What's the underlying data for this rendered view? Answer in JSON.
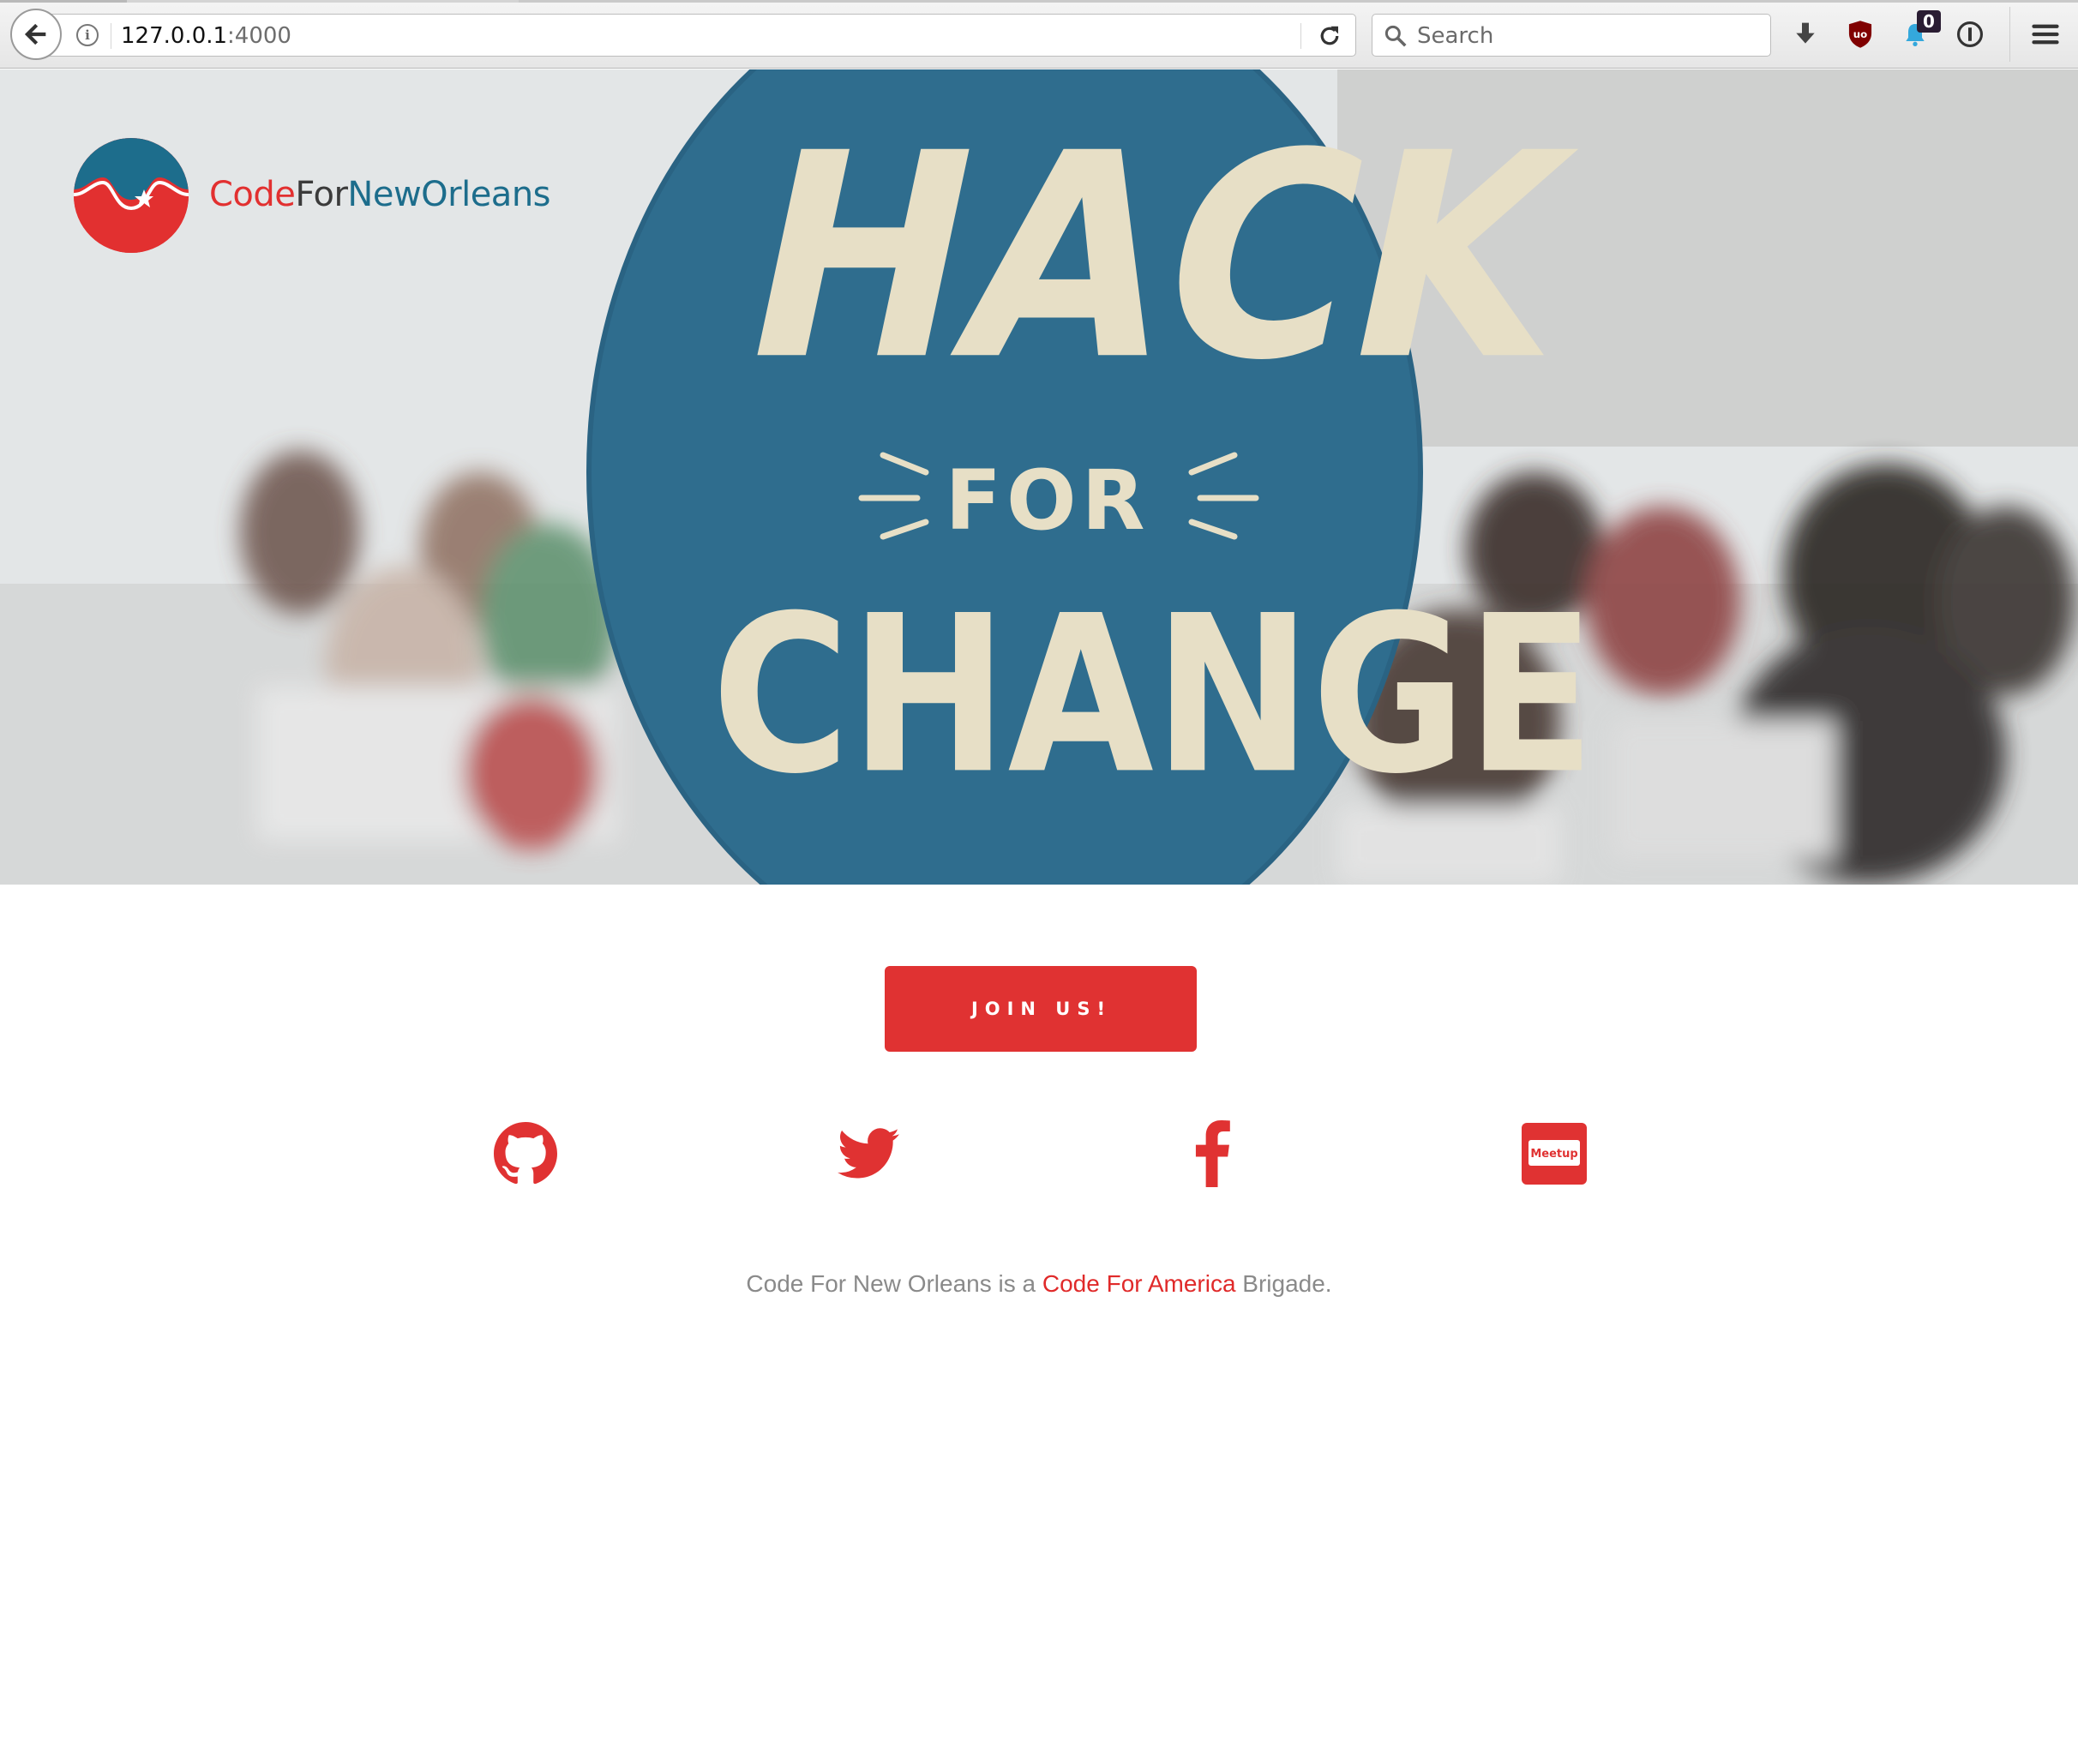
{
  "browser": {
    "url_host": "127.0.0.1",
    "url_port": ":4000",
    "search_placeholder": "Search",
    "notification_count": "0"
  },
  "icons": {
    "back": "back-arrow-icon",
    "info": "info-icon",
    "reload": "reload-icon",
    "search": "search-icon",
    "download": "download-icon",
    "ublock": "ublock-icon",
    "notifier": "bell-notifier-icon",
    "password_manager": "password-manager-icon",
    "menu": "hamburger-menu-icon"
  },
  "site": {
    "logo": {
      "part1": "Code",
      "part2": "For",
      "part3": "NewOrleans"
    },
    "hero_sign": {
      "line1": "HACK",
      "line2": "FOR",
      "line3": "CHANGE"
    },
    "join_button": "JOIN US!",
    "social": [
      {
        "name": "github",
        "icon": "github-icon"
      },
      {
        "name": "twitter",
        "icon": "twitter-icon"
      },
      {
        "name": "facebook",
        "icon": "facebook-icon"
      },
      {
        "name": "meetup",
        "icon": "meetup-icon",
        "label": "Meetup"
      }
    ],
    "footer": {
      "prefix": "Code For New Orleans is a ",
      "link": "Code For America",
      "suffix": " Brigade."
    }
  },
  "colors": {
    "brand_red": "#e03232",
    "brand_blue": "#1d6d8c",
    "sign_blue": "#2f6d8e",
    "sign_text": "#e7dfc6"
  }
}
